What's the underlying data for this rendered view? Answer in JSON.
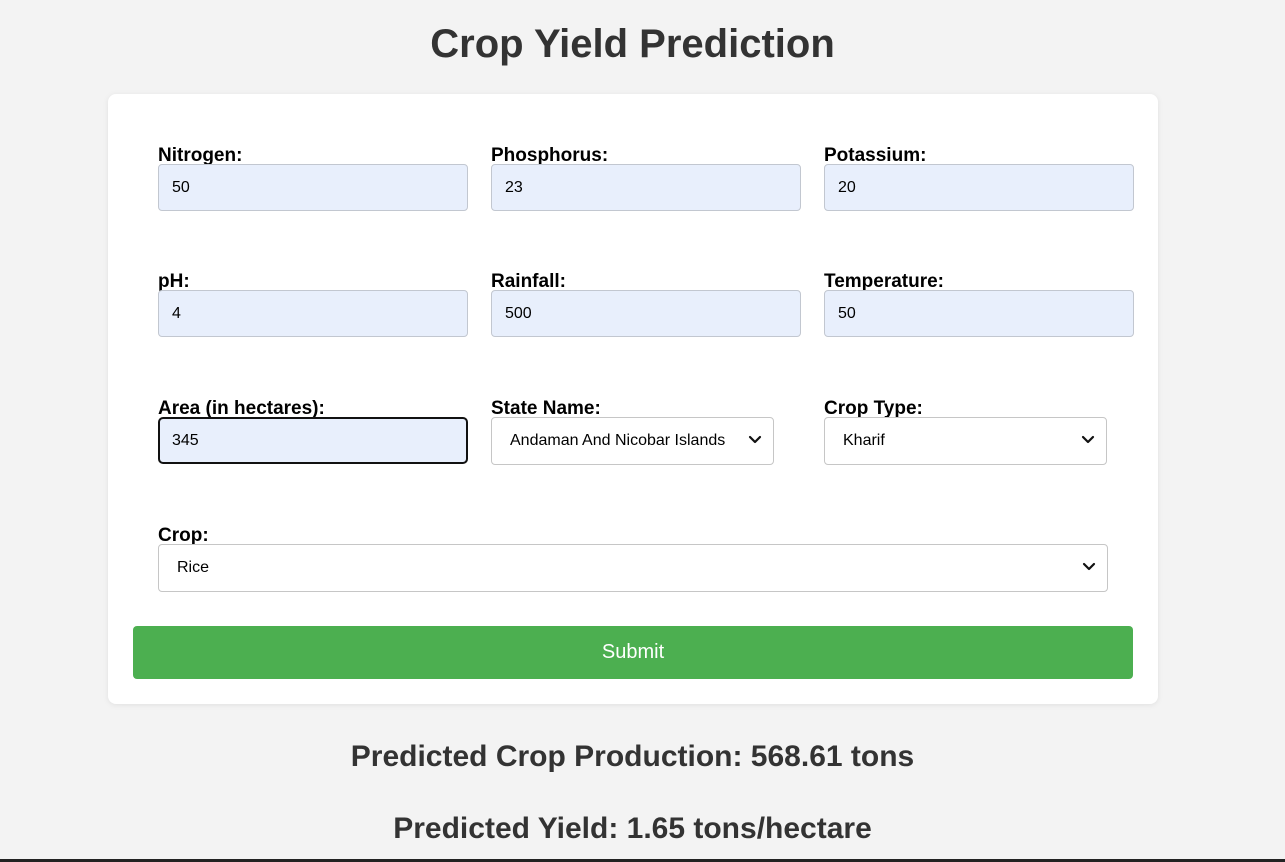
{
  "page": {
    "title": "Crop Yield Prediction"
  },
  "form": {
    "nitrogen": {
      "label": "Nitrogen:",
      "value": "50"
    },
    "phosphorus": {
      "label": "Phosphorus:",
      "value": "23"
    },
    "potassium": {
      "label": "Potassium:",
      "value": "20"
    },
    "ph": {
      "label": "pH:",
      "value": "4"
    },
    "rainfall": {
      "label": "Rainfall:",
      "value": "500"
    },
    "temperature": {
      "label": "Temperature:",
      "value": "50"
    },
    "area": {
      "label": "Area (in hectares):",
      "value": "345"
    },
    "state": {
      "label": "State Name:",
      "selected": "Andaman And Nicobar Islands"
    },
    "crop_type": {
      "label": "Crop Type:",
      "selected": "Kharif"
    },
    "crop": {
      "label": "Crop:",
      "selected": "Rice"
    },
    "submit_label": "Submit"
  },
  "results": {
    "production": "Predicted Crop Production: 568.61 tons",
    "yield": "Predicted Yield: 1.65 tons/hectare"
  },
  "colors": {
    "submit_button": "#4caf50",
    "input_background": "#e8effc",
    "page_background": "#f3f3f3"
  }
}
